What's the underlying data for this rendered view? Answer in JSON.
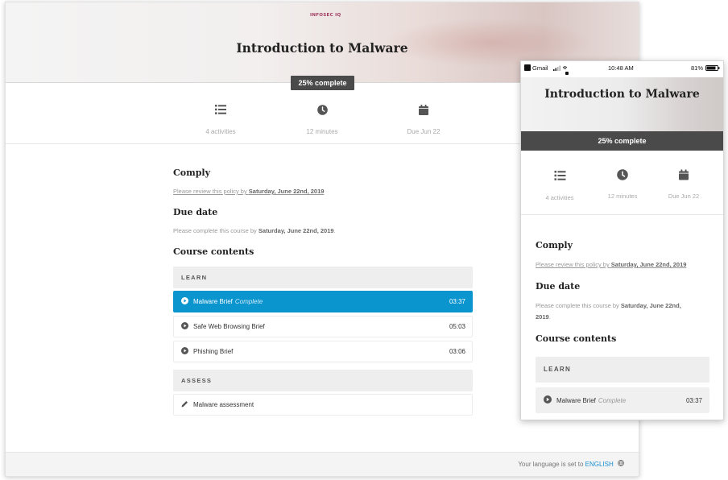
{
  "desktop": {
    "logo": "INFOSEC IQ",
    "title": "Introduction to Malware",
    "progress": "25% complete",
    "progress_value": 25,
    "stats": [
      {
        "icon": "list-icon",
        "label": "4 activities"
      },
      {
        "icon": "clock-icon",
        "label": "12 minutes"
      },
      {
        "icon": "calendar-icon",
        "label": "Due Jun 22"
      }
    ],
    "comply": {
      "heading": "Comply",
      "text": "Please review this policy by ",
      "date": "Saturday, June 22nd, 2019"
    },
    "due": {
      "heading": "Due date",
      "text": "Please complete this course by ",
      "date": "Saturday, June 22nd, 2019",
      "suffix": "."
    },
    "contents_heading": "Course contents",
    "sections": [
      {
        "title": "LEARN",
        "items": [
          {
            "icon": "play-icon",
            "name": "Malware Brief",
            "status": "Complete",
            "time": "03:37",
            "active": true
          },
          {
            "icon": "play-icon",
            "name": "Safe Web Browsing Brief",
            "status": "",
            "time": "05:03",
            "active": false
          },
          {
            "icon": "play-icon",
            "name": "Phishing Brief",
            "status": "",
            "time": "03:06",
            "active": false
          }
        ]
      },
      {
        "title": "ASSESS",
        "items": [
          {
            "icon": "pencil-icon",
            "name": "Malware assessment",
            "status": "",
            "time": "",
            "active": false
          }
        ]
      }
    ],
    "footer": {
      "text": "Your language is set to ",
      "language": "ENGLISH"
    }
  },
  "mobile": {
    "status_bar": {
      "app": "Gmail",
      "time": "10:48 AM",
      "battery": "81%"
    },
    "title": "Introduction to Malware",
    "progress": "25% complete",
    "stats": [
      {
        "icon": "list-icon",
        "label": "4 activities"
      },
      {
        "icon": "clock-icon",
        "label": "12 minutes"
      },
      {
        "icon": "calendar-icon",
        "label": "Due Jun 22"
      }
    ],
    "comply": {
      "heading": "Comply",
      "text": "Please review this policy by ",
      "date": "Saturday, June 22nd, 2019"
    },
    "due": {
      "heading": "Due date",
      "text": "Please complete this course by ",
      "date": "Saturday, June 22nd,",
      "date2": "2019",
      "suffix": "."
    },
    "contents_heading": "Course contents",
    "section_title": "LEARN",
    "item": {
      "name": "Malware Brief",
      "status": "Complete",
      "time": "03:37"
    }
  },
  "colors": {
    "accent": "#0b95cf",
    "progress_bg": "#4a4a4a",
    "language_link": "#1a8fd0"
  }
}
